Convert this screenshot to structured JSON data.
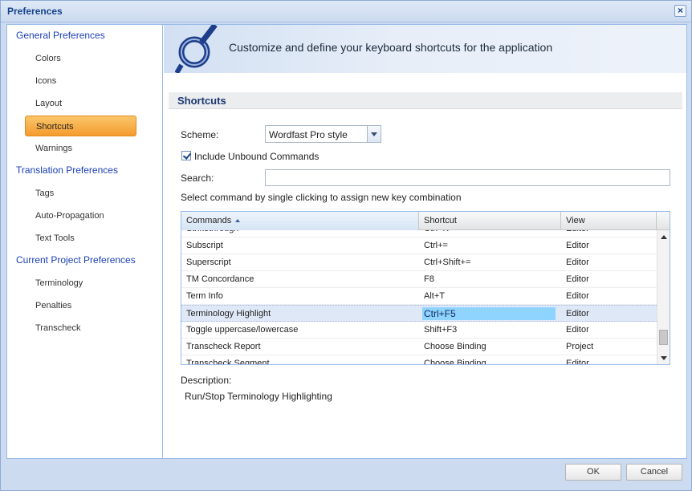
{
  "window": {
    "title": "Preferences"
  },
  "sidebar": {
    "groups": [
      {
        "label": "General Preferences",
        "items": [
          "Colors",
          "Icons",
          "Layout",
          "Shortcuts",
          "Warnings"
        ]
      },
      {
        "label": "Translation Preferences",
        "items": [
          "Tags",
          "Auto-Propagation",
          "Text Tools"
        ]
      },
      {
        "label": "Current Project Preferences",
        "items": [
          "Terminology",
          "Penalties",
          "Transcheck"
        ]
      }
    ],
    "selected": "Shortcuts"
  },
  "banner": {
    "text": "Customize and define your keyboard shortcuts for the application"
  },
  "section": {
    "title": "Shortcuts"
  },
  "form": {
    "scheme_label": "Scheme:",
    "scheme_value": "Wordfast Pro style",
    "include_unbound_label": "Include Unbound Commands",
    "include_unbound_checked": true,
    "search_label": "Search:",
    "search_value": "",
    "hint": "Select command by single clicking to assign new key combination"
  },
  "grid": {
    "columns": [
      "Commands",
      "Shortcut",
      "View"
    ],
    "sorted_column": "Commands",
    "sort_direction": "ascending",
    "rows": [
      {
        "command": "Strikethrough",
        "shortcut": "Ctrl+K",
        "view": "Editor"
      },
      {
        "command": "Subscript",
        "shortcut": "Ctrl+=",
        "view": "Editor"
      },
      {
        "command": "Superscript",
        "shortcut": "Ctrl+Shift+=",
        "view": "Editor"
      },
      {
        "command": "TM Concordance",
        "shortcut": "F8",
        "view": "Editor"
      },
      {
        "command": "Term Info",
        "shortcut": "Alt+T",
        "view": "Editor"
      },
      {
        "command": "Terminology Highlight",
        "shortcut": "Ctrl+F5",
        "view": "Editor",
        "selected": true
      },
      {
        "command": "Toggle uppercase/lowercase",
        "shortcut": "Shift+F3",
        "view": "Editor"
      },
      {
        "command": "Transcheck Report",
        "shortcut": "Choose Binding",
        "view": "Project"
      },
      {
        "command": "Transcheck Segment",
        "shortcut": "Choose Binding",
        "view": "Editor"
      }
    ]
  },
  "description": {
    "label": "Description:",
    "text": "Run/Stop Terminology Highlighting"
  },
  "buttons": {
    "ok": "OK",
    "cancel": "Cancel"
  },
  "colors": {
    "accent": "#f49b2e",
    "link": "#1a3fb5",
    "selection": "#8fd3ff",
    "frame": "#99bbe8"
  }
}
